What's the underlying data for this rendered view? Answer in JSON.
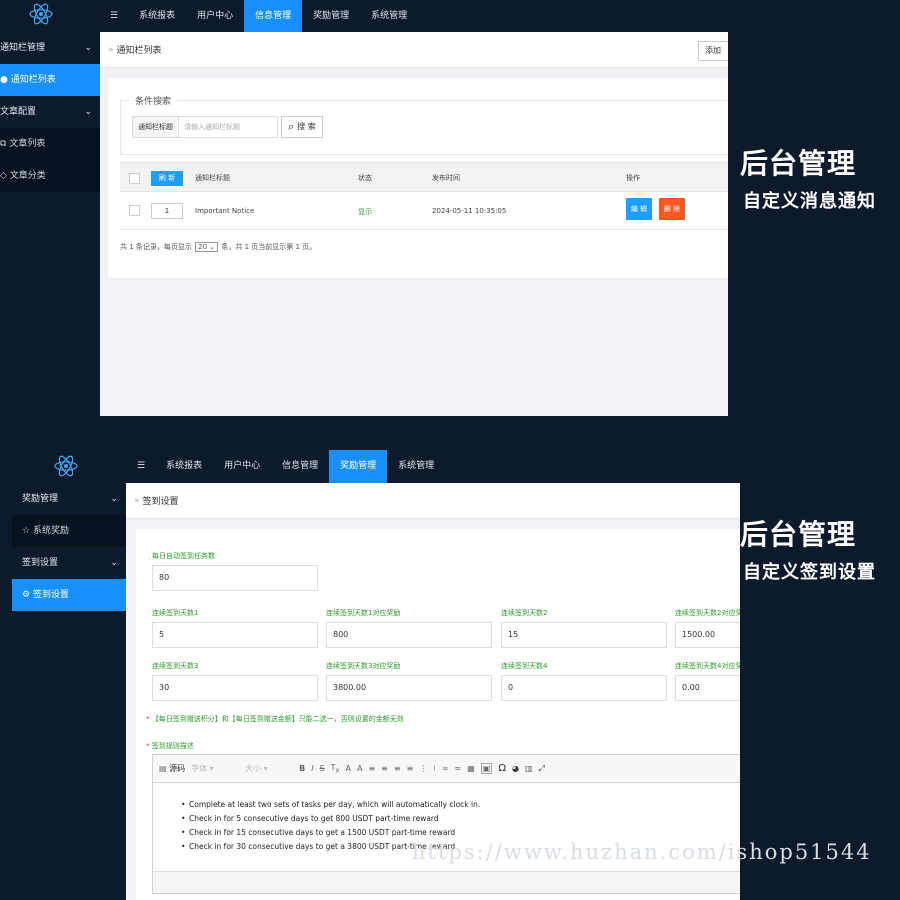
{
  "top_screen": {
    "nav": {
      "menu_icon": "☰",
      "items": [
        "系统报表",
        "用户中心",
        "信息管理",
        "奖励管理",
        "系统管理"
      ],
      "active": "信息管理"
    },
    "sidebar": {
      "groups": [
        {
          "label": "通知栏管理",
          "children": [
            {
              "label": "通知栏列表",
              "icon": "chat-icon",
              "active": true
            }
          ]
        },
        {
          "label": "文章配置",
          "children": [
            {
              "label": "文章列表",
              "icon": "book-icon"
            },
            {
              "label": "文章分类",
              "icon": "tag-icon"
            }
          ]
        }
      ]
    },
    "breadcrumb": "通知栏列表",
    "add_button": "添加",
    "search": {
      "legend": "条件搜索",
      "field_label": "通知栏标题",
      "placeholder": "请输入通知栏标题",
      "button": "搜 索"
    },
    "table": {
      "refresh_button": "刷 新",
      "headers": [
        "通知栏标题",
        "状态",
        "发布时间",
        "操作"
      ],
      "rows": [
        {
          "order": "1",
          "title": "Important Notice",
          "status": "显示",
          "time": "2024-05-11 10:35:05",
          "edit": "编 辑",
          "delete": "删 除"
        }
      ]
    },
    "pagination": {
      "prefix": "共 1 条记录，每页显示",
      "page_size": "20",
      "suffix": "条，共 1 页当前显示第 1 页。"
    }
  },
  "bottom_screen": {
    "nav": {
      "menu_icon": "☰",
      "items": [
        "系统报表",
        "用户中心",
        "信息管理",
        "奖励管理",
        "系统管理"
      ],
      "active": "奖励管理"
    },
    "sidebar": {
      "groups": [
        {
          "label": "奖励管理",
          "children": [
            {
              "label": "系统奖励",
              "icon": "star-icon"
            }
          ]
        },
        {
          "label": "签到设置",
          "children": [
            {
              "label": "签到设置",
              "icon": "gear-icon",
              "active": true
            }
          ]
        }
      ]
    },
    "breadcrumb": "签到设置",
    "form": {
      "auto_tasks_label": "每日自动签到任务数",
      "auto_tasks_value": "80",
      "fields_row1": [
        {
          "label": "连续签到天数1",
          "value": "5"
        },
        {
          "label": "连续签到天数1对应奖励",
          "value": "800"
        },
        {
          "label": "连续签到天数2",
          "value": "15"
        },
        {
          "label": "连续签到天数2对应奖",
          "value": "1500.00"
        }
      ],
      "fields_row2": [
        {
          "label": "连续签到天数3",
          "value": "30"
        },
        {
          "label": "连续签到天数3对应奖励",
          "value": "3800.00"
        },
        {
          "label": "连续签到天数4",
          "value": "0"
        },
        {
          "label": "连续签到天数4对应奖",
          "value": "0.00"
        }
      ],
      "warning": "【每日签到赠送积分】和【每日签到赠送金额】只能二选一，否则设置的金额无效",
      "rules_label": "签到规则描述",
      "editor_toolbar": {
        "source": "源码",
        "font": "字体",
        "size": "大小"
      },
      "rules": [
        "Complete at least two sets of tasks per day, which will automatically clock in.",
        "Check in for 5 consecutive days to get 800 USDT part-time reward",
        "Check in for 15 consecutive days to get a 1500 USDT part-time reward",
        "Check in for 30 consecutive days to get a 3800 USDT part-time reward"
      ]
    }
  },
  "captions": {
    "top_title": "后台管理",
    "top_subtitle": "自定义消息通知",
    "bottom_title": "后台管理",
    "bottom_subtitle": "自定义签到设置"
  },
  "watermark": "https://www.huzhan.com/ishop51544",
  "colors": {
    "accent": "#1890ff",
    "background": "#0c1a2c",
    "green_label": "#2e9a2e",
    "danger": "#ff5722"
  }
}
